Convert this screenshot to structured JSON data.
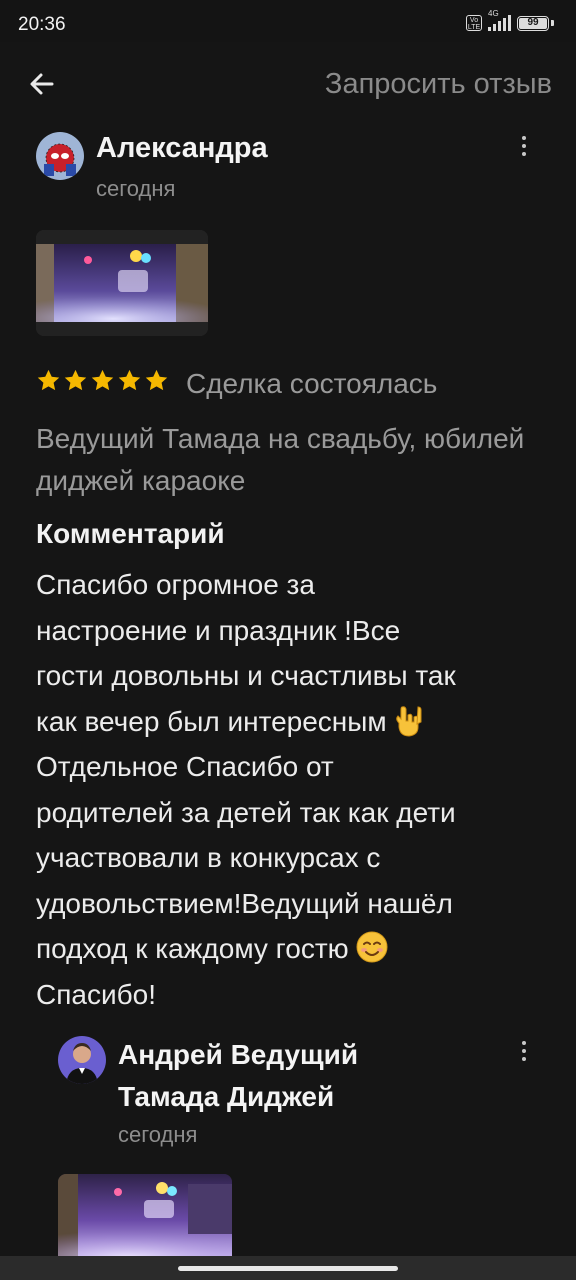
{
  "status_bar": {
    "time": "20:36",
    "network": "4G",
    "volte": "Vo LTE",
    "battery": "99"
  },
  "header": {
    "back_icon": "arrow-left-icon",
    "request_review_label": "Запросить отзыв"
  },
  "review": {
    "author_name": "Александра",
    "date": "сегодня",
    "rating": 5,
    "deal_status": "Сделка состоялась",
    "service_title": "Ведущий Тамада на свадьбу, юбилей диджей караоке",
    "comment_heading": "Комментарий",
    "comment_lines": [
      "Спасибо огромное за",
      "настроение и праздник !Все",
      "гости довольны и счастливы так",
      "как вечер был интересным",
      "Отдельное Спасибо от",
      "родителей за детей так как дети",
      "участвовали в конкурсах с",
      "удовольствием!Ведущий нашёл",
      "подход к каждому гостю",
      "Спасибо!"
    ],
    "emoji_1": "🤟",
    "emoji_2": "☺️"
  },
  "reply": {
    "author_name_line1": "Андрей Ведущий",
    "author_name_line2": "Тамада Диджей",
    "date": "сегодня"
  },
  "colors": {
    "background": "#151515",
    "star": "#f5b800",
    "muted_text": "#9a9a9a"
  }
}
